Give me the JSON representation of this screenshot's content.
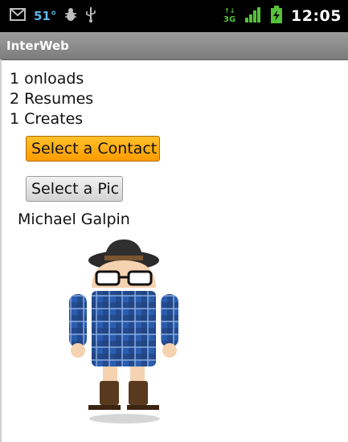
{
  "status_bar": {
    "icons": [
      "mail-icon",
      "bug-icon",
      "usb-icon",
      "3g-data-icon",
      "signal-icon",
      "battery-icon"
    ],
    "temperature": "51°",
    "time": "12:05"
  },
  "app": {
    "title": "InterWeb"
  },
  "counters": [
    "1 onloads",
    "2 Resumes",
    "1 Creates"
  ],
  "buttons": {
    "select_contact": "Select a Contact",
    "select_pic": "Select a Pic"
  },
  "contact_name": "Michael Galpin",
  "colors": {
    "status_bar_bg": "#000000",
    "title_bar_bg": "#8a8a8a",
    "accent_orange": "#ff9c00",
    "plaid_blue": "#2a5db0"
  }
}
